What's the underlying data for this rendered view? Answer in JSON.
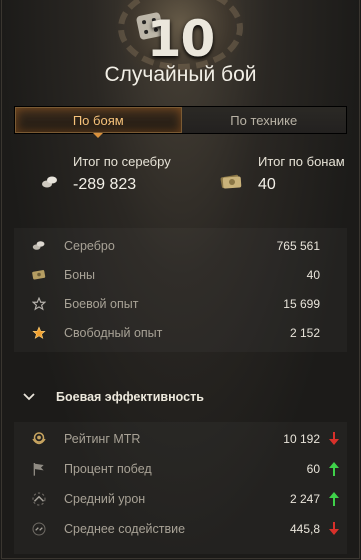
{
  "header": {
    "tier": "10",
    "title": "Случайный бой"
  },
  "tabs": [
    {
      "label": "По боям",
      "active": true
    },
    {
      "label": "По технике",
      "active": false
    }
  ],
  "totals": {
    "silver": {
      "label": "Итог по серебру",
      "value": "-289 823",
      "icon": "silver-icon"
    },
    "bonds": {
      "label": "Итог по бонам",
      "value": "40",
      "icon": "bonds-icon"
    }
  },
  "earnings": [
    {
      "label": "Серебро",
      "value": "765 561",
      "icon": "silver-icon"
    },
    {
      "label": "Боны",
      "value": "40",
      "icon": "bonds-icon"
    },
    {
      "label": "Боевой опыт",
      "value": "15 699",
      "icon": "star-outline-icon"
    },
    {
      "label": "Свободный опыт",
      "value": "2 152",
      "icon": "star-gold-icon"
    }
  ],
  "efficiency": {
    "title": "Боевая эффективность",
    "rows": [
      {
        "label": "Рейтинг MTR",
        "value": "10 192",
        "trend": "down",
        "icon": "mtr-rating-icon"
      },
      {
        "label": "Процент побед",
        "value": "60",
        "trend": "up",
        "icon": "flag-icon"
      },
      {
        "label": "Средний урон",
        "value": "2 247",
        "trend": "up",
        "icon": "damage-icon"
      },
      {
        "label": "Среднее содействие",
        "value": "445,8",
        "trend": "down",
        "icon": "assist-icon"
      }
    ]
  },
  "colors": {
    "accent": "#f6c27a",
    "trend_up": "#3fd24a",
    "trend_down": "#d8302a"
  }
}
